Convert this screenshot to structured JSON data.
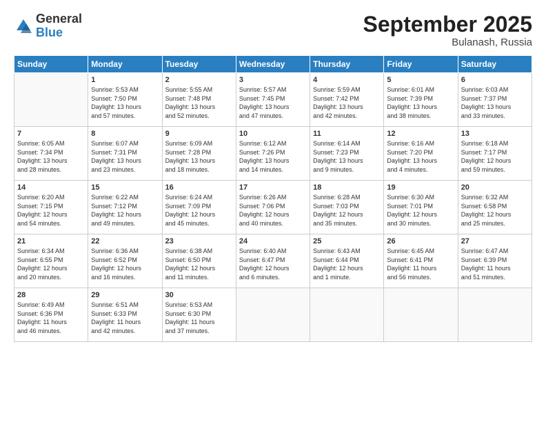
{
  "logo": {
    "general": "General",
    "blue": "Blue"
  },
  "header": {
    "month": "September 2025",
    "location": "Bulanash, Russia"
  },
  "weekdays": [
    "Sunday",
    "Monday",
    "Tuesday",
    "Wednesday",
    "Thursday",
    "Friday",
    "Saturday"
  ],
  "weeks": [
    [
      {
        "day": "",
        "content": ""
      },
      {
        "day": "1",
        "content": "Sunrise: 5:53 AM\nSunset: 7:50 PM\nDaylight: 13 hours\nand 57 minutes."
      },
      {
        "day": "2",
        "content": "Sunrise: 5:55 AM\nSunset: 7:48 PM\nDaylight: 13 hours\nand 52 minutes."
      },
      {
        "day": "3",
        "content": "Sunrise: 5:57 AM\nSunset: 7:45 PM\nDaylight: 13 hours\nand 47 minutes."
      },
      {
        "day": "4",
        "content": "Sunrise: 5:59 AM\nSunset: 7:42 PM\nDaylight: 13 hours\nand 42 minutes."
      },
      {
        "day": "5",
        "content": "Sunrise: 6:01 AM\nSunset: 7:39 PM\nDaylight: 13 hours\nand 38 minutes."
      },
      {
        "day": "6",
        "content": "Sunrise: 6:03 AM\nSunset: 7:37 PM\nDaylight: 13 hours\nand 33 minutes."
      }
    ],
    [
      {
        "day": "7",
        "content": "Sunrise: 6:05 AM\nSunset: 7:34 PM\nDaylight: 13 hours\nand 28 minutes."
      },
      {
        "day": "8",
        "content": "Sunrise: 6:07 AM\nSunset: 7:31 PM\nDaylight: 13 hours\nand 23 minutes."
      },
      {
        "day": "9",
        "content": "Sunrise: 6:09 AM\nSunset: 7:28 PM\nDaylight: 13 hours\nand 18 minutes."
      },
      {
        "day": "10",
        "content": "Sunrise: 6:12 AM\nSunset: 7:26 PM\nDaylight: 13 hours\nand 14 minutes."
      },
      {
        "day": "11",
        "content": "Sunrise: 6:14 AM\nSunset: 7:23 PM\nDaylight: 13 hours\nand 9 minutes."
      },
      {
        "day": "12",
        "content": "Sunrise: 6:16 AM\nSunset: 7:20 PM\nDaylight: 13 hours\nand 4 minutes."
      },
      {
        "day": "13",
        "content": "Sunrise: 6:18 AM\nSunset: 7:17 PM\nDaylight: 12 hours\nand 59 minutes."
      }
    ],
    [
      {
        "day": "14",
        "content": "Sunrise: 6:20 AM\nSunset: 7:15 PM\nDaylight: 12 hours\nand 54 minutes."
      },
      {
        "day": "15",
        "content": "Sunrise: 6:22 AM\nSunset: 7:12 PM\nDaylight: 12 hours\nand 49 minutes."
      },
      {
        "day": "16",
        "content": "Sunrise: 6:24 AM\nSunset: 7:09 PM\nDaylight: 12 hours\nand 45 minutes."
      },
      {
        "day": "17",
        "content": "Sunrise: 6:26 AM\nSunset: 7:06 PM\nDaylight: 12 hours\nand 40 minutes."
      },
      {
        "day": "18",
        "content": "Sunrise: 6:28 AM\nSunset: 7:03 PM\nDaylight: 12 hours\nand 35 minutes."
      },
      {
        "day": "19",
        "content": "Sunrise: 6:30 AM\nSunset: 7:01 PM\nDaylight: 12 hours\nand 30 minutes."
      },
      {
        "day": "20",
        "content": "Sunrise: 6:32 AM\nSunset: 6:58 PM\nDaylight: 12 hours\nand 25 minutes."
      }
    ],
    [
      {
        "day": "21",
        "content": "Sunrise: 6:34 AM\nSunset: 6:55 PM\nDaylight: 12 hours\nand 20 minutes."
      },
      {
        "day": "22",
        "content": "Sunrise: 6:36 AM\nSunset: 6:52 PM\nDaylight: 12 hours\nand 16 minutes."
      },
      {
        "day": "23",
        "content": "Sunrise: 6:38 AM\nSunset: 6:50 PM\nDaylight: 12 hours\nand 11 minutes."
      },
      {
        "day": "24",
        "content": "Sunrise: 6:40 AM\nSunset: 6:47 PM\nDaylight: 12 hours\nand 6 minutes."
      },
      {
        "day": "25",
        "content": "Sunrise: 6:43 AM\nSunset: 6:44 PM\nDaylight: 12 hours\nand 1 minute."
      },
      {
        "day": "26",
        "content": "Sunrise: 6:45 AM\nSunset: 6:41 PM\nDaylight: 11 hours\nand 56 minutes."
      },
      {
        "day": "27",
        "content": "Sunrise: 6:47 AM\nSunset: 6:39 PM\nDaylight: 11 hours\nand 51 minutes."
      }
    ],
    [
      {
        "day": "28",
        "content": "Sunrise: 6:49 AM\nSunset: 6:36 PM\nDaylight: 11 hours\nand 46 minutes."
      },
      {
        "day": "29",
        "content": "Sunrise: 6:51 AM\nSunset: 6:33 PM\nDaylight: 11 hours\nand 42 minutes."
      },
      {
        "day": "30",
        "content": "Sunrise: 6:53 AM\nSunset: 6:30 PM\nDaylight: 11 hours\nand 37 minutes."
      },
      {
        "day": "",
        "content": ""
      },
      {
        "day": "",
        "content": ""
      },
      {
        "day": "",
        "content": ""
      },
      {
        "day": "",
        "content": ""
      }
    ]
  ]
}
